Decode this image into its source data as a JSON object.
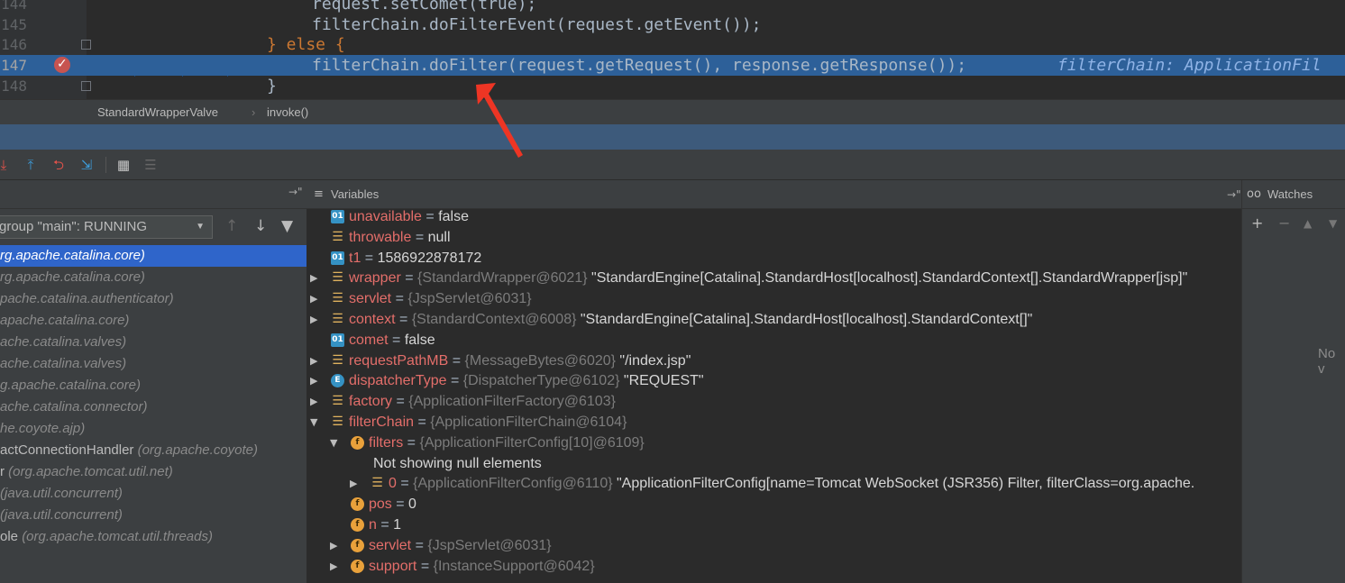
{
  "editor": {
    "lines": [
      {
        "num": "144",
        "code": "request.setComet(true);"
      },
      {
        "num": "145",
        "code": "filterChain.doFilterEvent(request.getEvent());"
      },
      {
        "num": "146",
        "kw": "} else {"
      },
      {
        "num": "147",
        "code": "filterChain.doFilter(request.getRequest(), response.getResponse());",
        "hint": "filterChain: ApplicationFil"
      },
      {
        "num": "148",
        "code": "}"
      }
    ]
  },
  "breadcrumbs": {
    "class": "StandardWrapperValve",
    "method": "invoke()"
  },
  "frames": {
    "thread": "group \"main\": RUNNING",
    "items": [
      {
        "meth": "",
        "pkg": "rg.apache.catalina.core)",
        "selected": true
      },
      {
        "meth": "",
        "pkg": "rg.apache.catalina.core)"
      },
      {
        "meth": "",
        "pkg": "pache.catalina.authenticator)"
      },
      {
        "meth": "",
        "pkg": "apache.catalina.core)"
      },
      {
        "meth": "",
        "pkg": "ache.catalina.valves)"
      },
      {
        "meth": "",
        "pkg": "ache.catalina.valves)"
      },
      {
        "meth": "",
        "pkg": "g.apache.catalina.core)"
      },
      {
        "meth": "",
        "pkg": "ache.catalina.connector)"
      },
      {
        "meth": "",
        "pkg": "he.coyote.ajp)"
      },
      {
        "meth": "actConnectionHandler ",
        "pkg": "(org.apache.coyote)"
      },
      {
        "meth": "r ",
        "pkg": "(org.apache.tomcat.util.net)"
      },
      {
        "meth": " ",
        "pkg": "(java.util.concurrent)"
      },
      {
        "meth": " ",
        "pkg": "(java.util.concurrent)"
      },
      {
        "meth": "ole ",
        "pkg": "(org.apache.tomcat.util.threads)"
      }
    ]
  },
  "variables": {
    "title": "Variables",
    "rows": [
      {
        "name": "unavailable",
        "eq": " = ",
        "val": "false",
        "icon": "prim",
        "indent": 0,
        "tri": ""
      },
      {
        "name": "throwable",
        "eq": " = ",
        "val": "null",
        "icon": "obj",
        "indent": 0,
        "tri": ""
      },
      {
        "name": "t1",
        "eq": " = ",
        "val": "1586922878172",
        "icon": "prim",
        "indent": 0,
        "tri": ""
      },
      {
        "name": "wrapper",
        "eq": " = ",
        "type": "{StandardWrapper@6021} ",
        "val": "\"StandardEngine[Catalina].StandardHost[localhost].StandardContext[].StandardWrapper[jsp]\"",
        "icon": "obj",
        "indent": 0,
        "tri": "▶"
      },
      {
        "name": "servlet",
        "eq": " = ",
        "type": "{JspServlet@6031}",
        "val": "",
        "icon": "obj",
        "indent": 0,
        "tri": "▶"
      },
      {
        "name": "context",
        "eq": " = ",
        "type": "{StandardContext@6008} ",
        "val": "\"StandardEngine[Catalina].StandardHost[localhost].StandardContext[]\"",
        "icon": "obj",
        "indent": 0,
        "tri": "▶"
      },
      {
        "name": "comet",
        "eq": " = ",
        "val": "false",
        "icon": "prim",
        "indent": 0,
        "tri": ""
      },
      {
        "name": "requestPathMB",
        "eq": " = ",
        "type": "{MessageBytes@6020} ",
        "val": "\"/index.jsp\"",
        "icon": "obj",
        "indent": 0,
        "tri": "▶"
      },
      {
        "name": "dispatcherType",
        "eq": " = ",
        "type": "{DispatcherType@6102} ",
        "val": "\"REQUEST\"",
        "icon": "enum",
        "indent": 0,
        "tri": "▶"
      },
      {
        "name": "factory",
        "eq": " = ",
        "type": "{ApplicationFilterFactory@6103}",
        "val": "",
        "icon": "obj",
        "indent": 0,
        "tri": "▶"
      },
      {
        "name": "filterChain",
        "eq": " = ",
        "type": "{ApplicationFilterChain@6104}",
        "val": "",
        "icon": "obj",
        "indent": 0,
        "tri": "▼"
      },
      {
        "name": "filters",
        "eq": " = ",
        "type": "{ApplicationFilterConfig[10]@6109}",
        "val": "",
        "icon": "field",
        "indent": 1,
        "tri": "▼"
      },
      {
        "plain": "Not showing null elements",
        "indent": 2,
        "tri": ""
      },
      {
        "name": "0",
        "eq": " = ",
        "type": "{ApplicationFilterConfig@6110} ",
        "val": "\"ApplicationFilterConfig[name=Tomcat WebSocket (JSR356) Filter, filterClass=org.apache.",
        "icon": "obj",
        "indent": 2,
        "tri": "▶"
      },
      {
        "name": "pos",
        "eq": " = ",
        "val": "0",
        "icon": "field",
        "indent": 1,
        "tri": ""
      },
      {
        "name": "n",
        "eq": " = ",
        "val": "1",
        "icon": "field",
        "indent": 1,
        "tri": ""
      },
      {
        "name": "servlet",
        "eq": " = ",
        "type": "{JspServlet@6031}",
        "val": "",
        "icon": "field",
        "indent": 1,
        "tri": "▶"
      },
      {
        "name": "support",
        "eq": " = ",
        "type": "{InstanceSupport@6042}",
        "val": "",
        "icon": "field",
        "indent": 1,
        "tri": "▶"
      }
    ]
  },
  "watches": {
    "title": "Watches",
    "empty_text": "No v"
  },
  "icon_names": {
    "obj": "object-field-icon",
    "prim": "primitive-field-icon",
    "field": "field-icon",
    "enum": "enum-icon"
  },
  "colors": {
    "current_line": "#2d6099",
    "selected_frame": "#2f65ca",
    "var_name": "#e36e6a",
    "arrow": "#ee3524"
  }
}
